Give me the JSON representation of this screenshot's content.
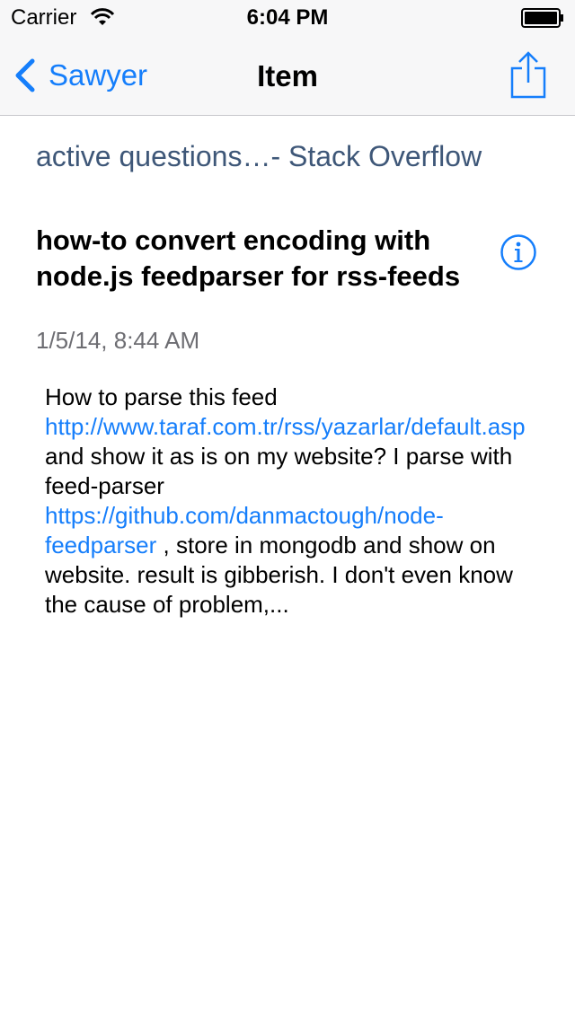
{
  "status_bar": {
    "carrier": "Carrier",
    "time": "6:04 PM",
    "icons": [
      "wifi-icon",
      "battery-icon"
    ]
  },
  "nav_bar": {
    "back_label": "Sawyer",
    "title": "Item",
    "icons": [
      "chevron-left-icon",
      "share-icon"
    ],
    "accent_color": "#157efb"
  },
  "item": {
    "feed_title": "active questions…- Stack Overflow",
    "title": "how-to convert encoding with node.js feedparser for rss-feeds",
    "info_icon": "info-icon",
    "date": "1/5/14, 8:44 AM",
    "body": {
      "text_1": "How to parse this feed ",
      "link_1": "http://www.taraf.com.tr/rss/yazarlar/default.asp",
      "text_2": " and show it as is on my website? I parse with feed-parser ",
      "link_2": "https://github.com/danmactough/node-feedparser",
      "text_3": " , store in mongodb and show on website. result is gibberish. I don't even know the cause of problem,..."
    }
  }
}
